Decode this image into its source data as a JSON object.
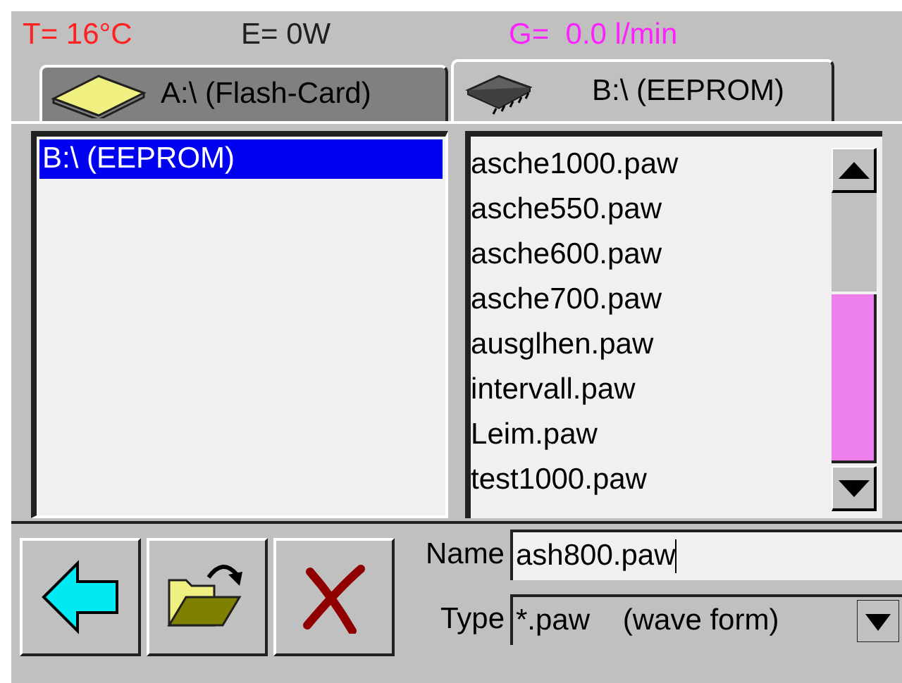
{
  "status": [
    {
      "text": "T= 16°C",
      "color": "#ff2020"
    },
    {
      "text": "E= 0W",
      "color": "#202020"
    },
    {
      "text": "G=  0.0 l/min",
      "color": "#ff20ff"
    }
  ],
  "tabs": [
    {
      "label": "A:\\ (Flash-Card)",
      "kind": "card",
      "selected": false
    },
    {
      "label": "B:\\ (EEPROM)",
      "kind": "chip",
      "selected": true
    }
  ],
  "drives": [
    {
      "label": "B:\\ (EEPROM)",
      "selected": true
    }
  ],
  "files": [
    "asche1000.paw",
    "asche550.paw",
    "asche600.paw",
    "asche700.paw",
    "ausglhen.paw",
    "intervall.paw",
    "Leim.paw",
    "test1000.paw"
  ],
  "buttons": [
    {
      "kind": "back"
    },
    {
      "kind": "open"
    },
    {
      "kind": "delete"
    }
  ],
  "name_field": {
    "label": "Name",
    "value": "ash800.paw"
  },
  "type_field": {
    "label": "Type",
    "value": "*.paw    (wave form)"
  }
}
